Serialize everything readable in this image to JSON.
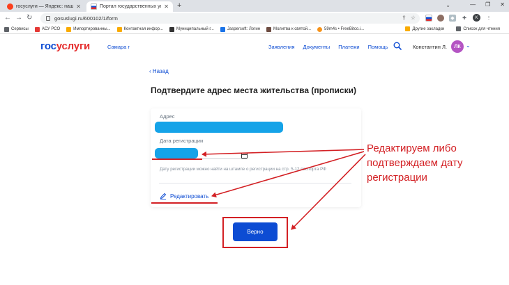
{
  "browser": {
    "tabs": [
      {
        "title": "госуслуги — Яндекс: нашлось 3",
        "active": false
      },
      {
        "title": "Портал государственных услуг",
        "active": true
      }
    ],
    "new_tab": "+",
    "url": "gosuslugi.ru/600102/1/form",
    "bookmarks": [
      {
        "label": "Сервисы",
        "icon_color": "#5f6368"
      },
      {
        "label": "АСУ РСО",
        "icon_color": "#e53935"
      },
      {
        "label": "Импортированны...",
        "icon_color": "#f9ab00"
      },
      {
        "label": "Контактная инфор...",
        "icon_color": "#f9ab00"
      },
      {
        "label": "Муниципальный г...",
        "icon_color": "#333333"
      },
      {
        "label": "Jaspersoft: Логин",
        "icon_color": "#1a73e8"
      },
      {
        "label": "Молитва к святой...",
        "icon_color": "#6d4c41"
      },
      {
        "label": "59m4s • FreeBitco.i...",
        "icon_color": "#f7931a"
      }
    ],
    "bookmarks_right": [
      {
        "label": "Другие закладки",
        "icon_color": "#f9ab00"
      },
      {
        "label": "Список для чтения",
        "icon_color": "#5f6368"
      }
    ],
    "profile_letter": "K"
  },
  "site": {
    "logo_part1": "гос",
    "logo_part2": "услуги",
    "region": "Самара г",
    "nav": [
      "Заявления",
      "Документы",
      "Платежи",
      "Помощь"
    ],
    "user_name": "Константин Л.",
    "avatar_initials": "ЛК"
  },
  "form": {
    "back_label": "‹  Назад",
    "title": "Подтвердите адрес места жительства (прописки)",
    "address_label": "Адрес",
    "registration_date_label": "Дата регистрации",
    "hint": "Дату регистрации можно найти на штампе о регистрации на стр. 5-12 паспорта РФ",
    "edit_label": "Редактировать",
    "confirm_label": "Верно"
  },
  "annotation": {
    "lines": [
      "Редактируем либо",
      "подтверждаем дату",
      "регистрации"
    ],
    "color": "#d32024"
  },
  "colors": {
    "brand_blue": "#0d4cd3",
    "brand_red": "#e52f2f",
    "redaction": "#15a3e8"
  }
}
